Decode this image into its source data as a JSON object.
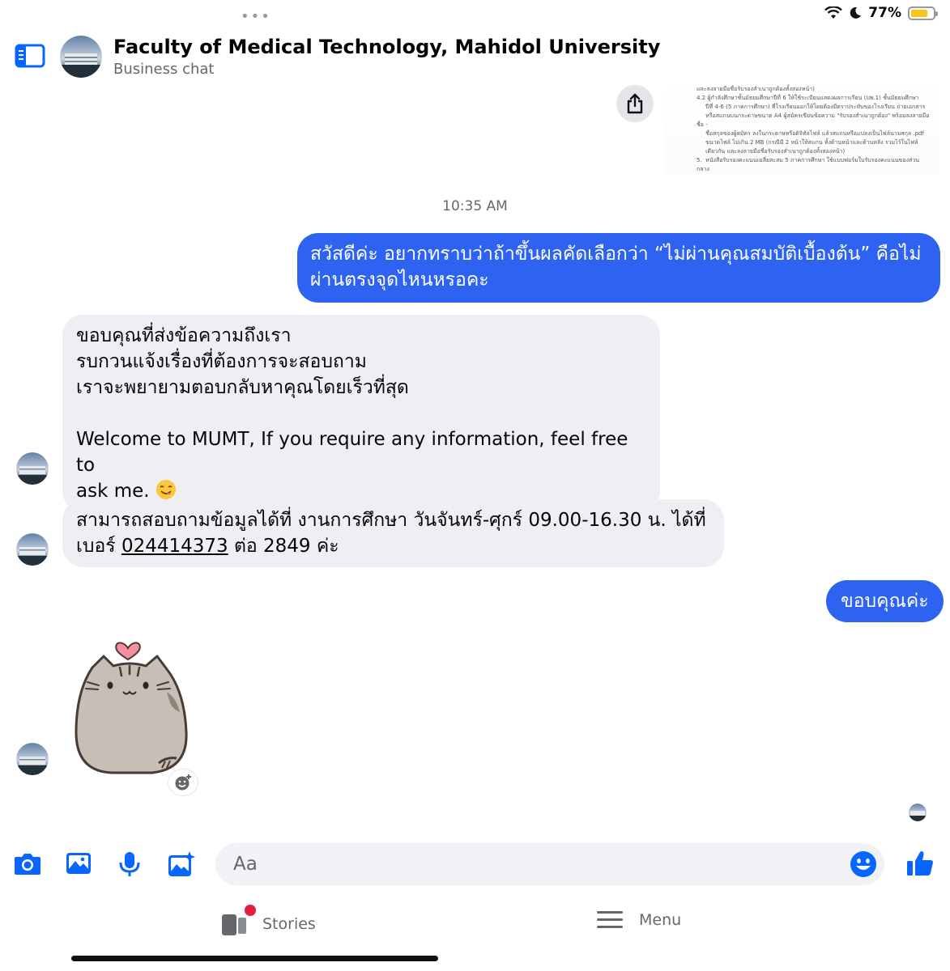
{
  "status_bar": {
    "battery": "77%",
    "battery_level": 0.77,
    "battery_color": "#f5c518"
  },
  "header": {
    "title": "Faculty of Medical Technology, Mahidol University",
    "subtitle": "Business chat",
    "icons": [
      "sidebar-icon",
      "phone-icon"
    ]
  },
  "document_preview": {
    "text": "และลงลายมือชื่อรับรองสำเนาถูกต้องทั้งสองหน้า)\n4.2 ผู้กำลังศึกษาชั้นมัธยมศึกษาปีที่ 6 ให้ใช้ระเบียนแสดงผลการเรียน (ปพ.1) ชั้นมัธยมศึกษา\n     ปีที่ 4-6 (5 ภาคการศึกษา) ที่โรงเรียนออกให้โดยต้องมีตราประทับของโรงเรียน ถ่ายเอกสาร\n     หรือสแกนบนกระดาษขนาด A4 ผู้สมัครเขียนข้อความ \"รับรองสำเนาถูกต้อง\" พร้อมลงลายมือชื่อ -\n     ชื่อสกุลของผู้สมัคร ลงในกระดาษหรือดิจิทัลไฟล์ แล้วสแกนหรือแปลงเป็นไฟล์นามสกุล .pdf\n     ขนาดไฟล์ ไม่เกิน 2 MB (กรณีมี 2 หน้าให้สแกน ทั้งด้านหน้าและด้านหลัง รวมไว้ในไฟล์\n     เดียวกัน และลงลายมือชื่อรับรองสำเนาถูกต้องทั้งสองหน้า)\n5.  หนังสือรับรองคะแนนเฉลี่ยสะสม 5 ภาคการศึกษา ใช้แบบฟอร์มใบรับรองคะแนนของส่วนกลาง\n     ดาวน์โหลดเอกสารที่ https://tcas.mahidol.ac.th/"
  },
  "timestamp": "10:35 AM",
  "messages": {
    "msg1": {
      "line1": "สวัสดีค่ะ อยากทราบว่าถ้าขึ้นผลคัดเลือกว่า “ไม่ผ่านคุณสมบัติเบื้องต้น” คือไม่",
      "line2": "ผ่านตรงจุดไหนหรอคะ"
    },
    "msg2": {
      "line1": "ขอบคุณที่ส่งข้อความถึงเรา",
      "line2": "รบกวนแจ้งเรื่องที่ต้องการจะสอบถาม",
      "line3": "เราจะพยายามตอบกลับหาคุณโดยเร็วที่สุด",
      "line4": "Welcome to MUMT, If you require any information, feel free to",
      "line5": "ask me."
    },
    "msg3": {
      "line1": "สามารถสอบถามข้อมูลได้ที่ งานการศึกษา วันจันทร์-ศุกร์ 09.00-16.30 น. ได้ที่",
      "line2_prefix": "เบอร์ ",
      "phone": "024414373",
      "line2_suffix": " ต่อ 2849 ค่ะ"
    },
    "msg4": {
      "text": "ขอบคุณค่ะ"
    }
  },
  "composer": {
    "placeholder": "Aa",
    "icons": [
      "camera-icon",
      "gallery-icon",
      "microphone-icon",
      "ai-image-icon",
      "emoji-icon",
      "thumbs-up-icon"
    ]
  },
  "tabbar": {
    "stories_label": "Stories",
    "menu_label": "Menu"
  },
  "colors": {
    "accent": "#0866ff",
    "outgoing_bubble": "#2d63f0",
    "incoming_bubble": "#eeeff2",
    "notification": "#e41e3f"
  }
}
